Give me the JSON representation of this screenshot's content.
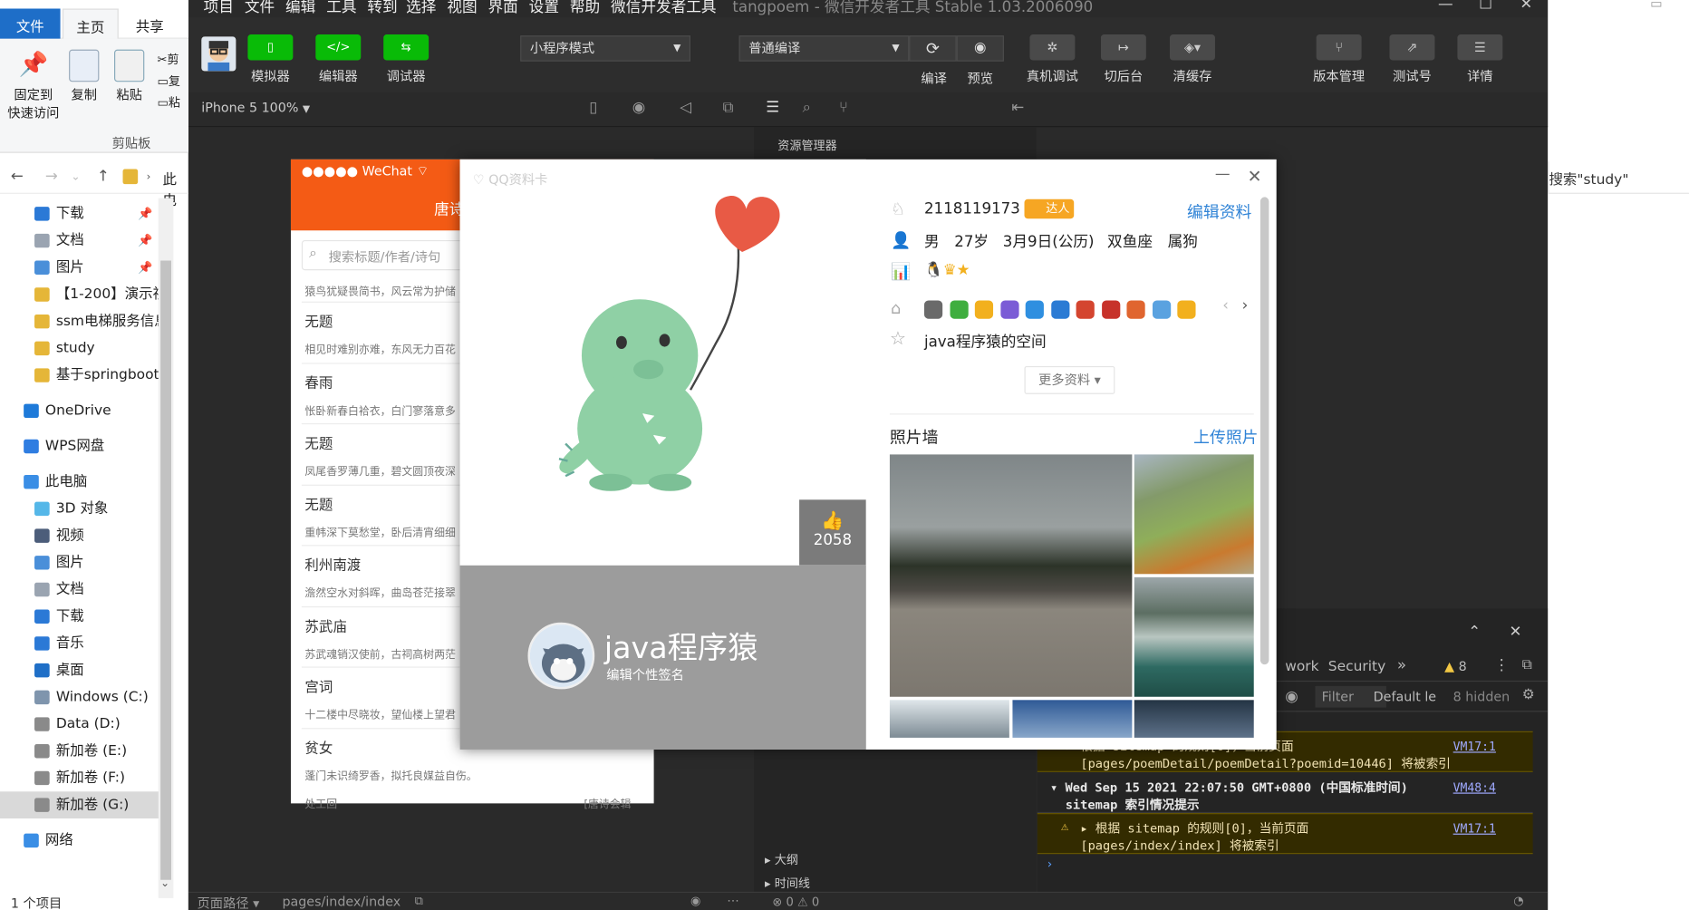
{
  "explorer": {
    "tabs": [
      "文件",
      "主页",
      "共享"
    ],
    "ribbon": {
      "pin": "固定到",
      "pin2": "快速访问",
      "copy": "复制",
      "paste": "粘贴",
      "cut": "剪",
      "copy_path": "复",
      "paste_short": "粘",
      "group": "剪贴板"
    },
    "address": "此电",
    "tree": [
      {
        "label": "下载",
        "color": "#2b79d6",
        "pin": true
      },
      {
        "label": "文档",
        "color": "#9aa4b1",
        "pin": true
      },
      {
        "label": "图片",
        "color": "#4a8fd9",
        "pin": true
      },
      {
        "label": "【1-200】演示视",
        "color": "#e5b638"
      },
      {
        "label": "ssm电梯服务信息",
        "color": "#e5b638"
      },
      {
        "label": "study",
        "color": "#e5b638"
      },
      {
        "label": "基于springboot",
        "color": "#e5b638"
      },
      {
        "label": "OneDrive",
        "color": "#1e7ad9",
        "gap": true
      },
      {
        "label": "WPS网盘",
        "color": "#2f7de1",
        "gap": true
      },
      {
        "label": "此电脑",
        "color": "#3a8ee5",
        "gap": true
      },
      {
        "label": "3D 对象",
        "color": "#55b7e8"
      },
      {
        "label": "视频",
        "color": "#4c5d7a"
      },
      {
        "label": "图片",
        "color": "#4a8fd9"
      },
      {
        "label": "文档",
        "color": "#9aa4b1"
      },
      {
        "label": "下载",
        "color": "#2b79d6"
      },
      {
        "label": "音乐",
        "color": "#2b79d6"
      },
      {
        "label": "桌面",
        "color": "#1f6fc7"
      },
      {
        "label": "Windows (C:)",
        "color": "#7f95ad"
      },
      {
        "label": "Data (D:)",
        "color": "#8a8a8a"
      },
      {
        "label": "新加卷 (E:)",
        "color": "#8a8a8a"
      },
      {
        "label": "新加卷 (F:)",
        "color": "#8a8a8a"
      },
      {
        "label": "新加卷 (G:)",
        "color": "#8a8a8a",
        "selected": true
      },
      {
        "label": "网络",
        "color": "#3a8ee5",
        "gap": true
      }
    ],
    "status": "1 个项目"
  },
  "ide": {
    "menu": [
      "项目",
      "文件",
      "编辑",
      "工具",
      "转到",
      "选择",
      "视图",
      "界面",
      "设置",
      "帮助",
      "微信开发者工具"
    ],
    "window_title": "tangpoem - 微信开发者工具 Stable 1.03.2006090",
    "toolbar": {
      "simulator": "模拟器",
      "editor": "编辑器",
      "debugger": "调试器",
      "mode": "小程序模式",
      "compile_mode": "普通编译",
      "compile": "编译",
      "preview": "预览",
      "remote_debug": "真机调试",
      "background": "切后台",
      "clear_cache": "清缓存",
      "version": "版本管理",
      "test": "测试号",
      "details": "详情"
    },
    "device": "iPhone 5 100%",
    "panel_title": "资源管理器",
    "outline": "大纲",
    "timeline": "时间线",
    "status_path_label": "页面路径",
    "status_path": "pages/index/index",
    "status_errors": "⊗ 0 ⚠ 0"
  },
  "phone": {
    "carrier": "●●●●● WeChat",
    "title": "唐诗",
    "search_placeholder": "搜索标题/作者/诗句",
    "first_line": "猿鸟犹疑畏简书，风云常为护储",
    "items": [
      {
        "title": "无题",
        "sub": "相见时难别亦难，东风无力百花"
      },
      {
        "title": "春雨",
        "sub": "怅卧新春白袷衣，白门寥落意多"
      },
      {
        "title": "无题",
        "sub": "凤尾香罗薄几重，碧文圆顶夜深"
      },
      {
        "title": "无题",
        "sub": "重帏深下莫愁堂，卧后清宵细细"
      },
      {
        "title": "利州南渡",
        "sub": "澹然空水对斜晖，曲岛苍茫接翠"
      },
      {
        "title": "苏武庙",
        "sub": "苏武魂销汉使前，古祠高树两茫"
      },
      {
        "title": "宫词",
        "sub": "十二楼中尽晓妆，望仙楼上望君"
      },
      {
        "title": "贫女",
        "sub": "蓬门未识绮罗香，拟托良媒益自伤。"
      }
    ],
    "bottom_cut_left": "处工回",
    "bottom_cut_right": "[唐诗会辑"
  },
  "console": {
    "tabs": {
      "network": "work",
      "security": "Security",
      "warnings": "8"
    },
    "filter": "Filter",
    "level": "Default le",
    "hidden": "8 hidden",
    "lines": [
      {
        "text": "▸ 根据 sitemap 的规则[0]，当前页面",
        "link": "VM17:1"
      },
      {
        "text": "[pages/poemDetail/poemDetail?poemid=10446] 将被索引"
      },
      {
        "text": "▾ Wed Sep 15 2021 22:07:50 GMT+0800 (中国标准时间)",
        "link": "VM48:4"
      },
      {
        "text": "sitemap 索引情况提示"
      },
      {
        "text": "▸ 根据 sitemap 的规则[0]，当前页面",
        "link": "VM17:1"
      },
      {
        "text": "[pages/index/index] 将被索引"
      }
    ]
  },
  "right_fragment": {
    "search": "搜索\"study\""
  },
  "dialog": {
    "watermark": "QQ资料卡",
    "qq": "2118119173",
    "edit": "编辑资料",
    "gender": "男",
    "age": "27岁",
    "birthday": "3月9日(公历)",
    "constellation": "双鱼座",
    "zodiac": "属狗",
    "space": "java程序猿的空间",
    "more": "更多资料",
    "photo_wall": "照片墙",
    "upload": "上传照片",
    "likes": "2058",
    "nickname": "java程序猿",
    "signature": "编辑个性签名",
    "daren": "达人"
  },
  "colors": {
    "accent": "#09bb07",
    "orange": "#f45b15",
    "link": "#2f83d6",
    "dialog_gray": "#9c9c9c"
  }
}
